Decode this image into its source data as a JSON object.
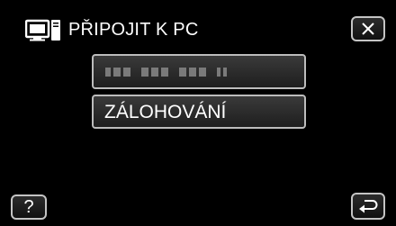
{
  "header": {
    "title": "PŘIPOJIT K PC",
    "icon": "pc-monitor-icon"
  },
  "menu": {
    "items": [
      {
        "label": "",
        "icon": "masked-text-icon"
      },
      {
        "label": "ZÁLOHOVÁNÍ"
      }
    ]
  },
  "buttons": {
    "close_icon": "close-icon",
    "help_label": "?",
    "back_icon": "return-icon"
  },
  "colors": {
    "background": "#000000",
    "text": "#ffffff",
    "border": "#c4c4c4"
  }
}
